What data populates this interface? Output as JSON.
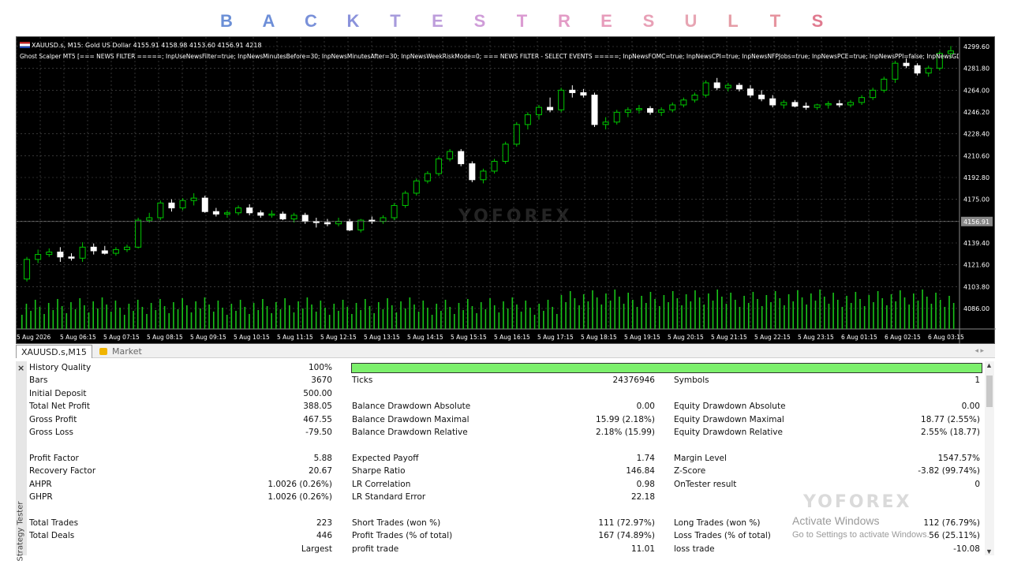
{
  "header_title_letters": [
    {
      "ch": "B",
      "color": "#6b8fd6"
    },
    {
      "ch": "A",
      "color": "#6e8fd8"
    },
    {
      "ch": "C",
      "color": "#7a91d9"
    },
    {
      "ch": "K",
      "color": "#8a92db"
    },
    {
      "ch": "T",
      "color": "#a79bdc"
    },
    {
      "ch": "E",
      "color": "#bd9ddb"
    },
    {
      "ch": "S",
      "color": "#cf9cd8"
    },
    {
      "ch": "T",
      "color": "#db9bd2"
    },
    {
      "ch": "R",
      "color": "#e39cc6"
    },
    {
      "ch": "E",
      "color": "#e79cbb"
    },
    {
      "ch": "S",
      "color": "#e8a0b6"
    },
    {
      "ch": "U",
      "color": "#e7a5b3"
    },
    {
      "ch": "L",
      "color": "#e59ca6"
    },
    {
      "ch": "T",
      "color": "#e6949f"
    },
    {
      "ch": "S",
      "color": "#e07a8f"
    }
  ],
  "chart": {
    "symbol_line": "XAUUSD.s, M15:  Gold US Dollar  4155.91 4158.98 4153.60 4156.91  4218",
    "ea_line": "Ghost Scalper MT5 [=== NEWS FILTER =====; InpUseNewsFilter=true; InpNewsMinutesBefore=30; InpNewsMinutesAfter=30; InpNewsWeekRiskMode=0; === NEWS FILTER - SELECT EVENTS =====; InpNewsFOMC=true; InpNewsCPI=true; InpNewsNFPJobs=true; InpNewsPCE=true; InpNewsPPI=false; InpNewsGD",
    "watermark": "YOFOREX",
    "current_price": "4156.91",
    "colors": {
      "bg": "#000000",
      "grid": "#555555",
      "up": "#00c800",
      "down": "#ffffff",
      "volume": "#19c419",
      "text": "#ffffff"
    }
  },
  "chart_data": {
    "type": "candlestick",
    "price_axis_ticks": [
      "4299.60",
      "4281.80",
      "4264.00",
      "4246.20",
      "4228.40",
      "4210.60",
      "4192.80",
      "4175.00",
      "4157.20",
      "4139.40",
      "4121.60",
      "4103.80",
      "4086.00"
    ],
    "time_axis_ticks": [
      "5 Aug 2026",
      "5 Aug 06:15",
      "5 Aug 07:15",
      "5 Aug 08:15",
      "5 Aug 09:15",
      "5 Aug 10:15",
      "5 Aug 11:15",
      "5 Aug 12:15",
      "5 Aug 13:15",
      "5 Aug 14:15",
      "5 Aug 15:15",
      "5 Aug 16:15",
      "5 Aug 17:15",
      "5 Aug 18:15",
      "5 Aug 19:15",
      "5 Aug 20:15",
      "5 Aug 21:15",
      "5 Aug 22:15",
      "5 Aug 23:15",
      "6 Aug 01:15",
      "6 Aug 02:15",
      "6 Aug 03:15"
    ],
    "ylim": [
      4086.0,
      4299.6
    ],
    "candles": [
      [
        4110,
        4128,
        4108,
        4126
      ],
      [
        4126,
        4134,
        4123,
        4130
      ],
      [
        4130,
        4135,
        4128,
        4132
      ],
      [
        4132,
        4136,
        4124,
        4128
      ],
      [
        4128,
        4131,
        4125,
        4127
      ],
      [
        4127,
        4140,
        4124,
        4136
      ],
      [
        4136,
        4139,
        4130,
        4133
      ],
      [
        4133,
        4137,
        4130,
        4131
      ],
      [
        4131,
        4136,
        4129,
        4134
      ],
      [
        4134,
        4138,
        4132,
        4136
      ],
      [
        4136,
        4160,
        4135,
        4158
      ],
      [
        4158,
        4164,
        4156,
        4160
      ],
      [
        4160,
        4174,
        4158,
        4172
      ],
      [
        4172,
        4175,
        4165,
        4168
      ],
      [
        4168,
        4176,
        4166,
        4174
      ],
      [
        4174,
        4180,
        4170,
        4176
      ],
      [
        4176,
        4178,
        4164,
        4165
      ],
      [
        4165,
        4168,
        4161,
        4163
      ],
      [
        4163,
        4166,
        4160,
        4164
      ],
      [
        4164,
        4170,
        4162,
        4168
      ],
      [
        4168,
        4171,
        4162,
        4164
      ],
      [
        4164,
        4166,
        4160,
        4162
      ],
      [
        4162,
        4166,
        4160,
        4163
      ],
      [
        4163,
        4165,
        4158,
        4159
      ],
      [
        4159,
        4164,
        4156,
        4162
      ],
      [
        4162,
        4164,
        4155,
        4157
      ],
      [
        4157,
        4160,
        4152,
        4156
      ],
      [
        4156,
        4159,
        4153,
        4155
      ],
      [
        4155,
        4160,
        4153,
        4157
      ],
      [
        4157,
        4159,
        4149,
        4150
      ],
      [
        4150,
        4159,
        4148,
        4158
      ],
      [
        4158,
        4161,
        4155,
        4157
      ],
      [
        4157,
        4162,
        4155,
        4160
      ],
      [
        4160,
        4172,
        4158,
        4170
      ],
      [
        4170,
        4182,
        4168,
        4180
      ],
      [
        4180,
        4192,
        4178,
        4190
      ],
      [
        4190,
        4198,
        4188,
        4196
      ],
      [
        4196,
        4210,
        4194,
        4208
      ],
      [
        4208,
        4216,
        4206,
        4214
      ],
      [
        4214,
        4216,
        4202,
        4204
      ],
      [
        4204,
        4206,
        4189,
        4191
      ],
      [
        4191,
        4200,
        4188,
        4198
      ],
      [
        4198,
        4208,
        4196,
        4206
      ],
      [
        4206,
        4222,
        4204,
        4220
      ],
      [
        4220,
        4238,
        4218,
        4236
      ],
      [
        4236,
        4246,
        4232,
        4244
      ],
      [
        4244,
        4252,
        4240,
        4250
      ],
      [
        4250,
        4258,
        4246,
        4248
      ],
      [
        4248,
        4266,
        4246,
        4264
      ],
      [
        4264,
        4268,
        4258,
        4262
      ],
      [
        4262,
        4265,
        4258,
        4260
      ],
      [
        4260,
        4262,
        4234,
        4236
      ],
      [
        4236,
        4242,
        4232,
        4238
      ],
      [
        4238,
        4248,
        4236,
        4246
      ],
      [
        4246,
        4250,
        4242,
        4248
      ],
      [
        4248,
        4252,
        4245,
        4249
      ],
      [
        4249,
        4251,
        4244,
        4246
      ],
      [
        4246,
        4250,
        4243,
        4248
      ],
      [
        4248,
        4254,
        4246,
        4252
      ],
      [
        4252,
        4258,
        4250,
        4256
      ],
      [
        4256,
        4262,
        4254,
        4260
      ],
      [
        4260,
        4272,
        4258,
        4270
      ],
      [
        4270,
        4274,
        4264,
        4266
      ],
      [
        4266,
        4270,
        4263,
        4268
      ],
      [
        4268,
        4270,
        4263,
        4265
      ],
      [
        4265,
        4268,
        4258,
        4260
      ],
      [
        4260,
        4264,
        4255,
        4257
      ],
      [
        4257,
        4260,
        4250,
        4252
      ],
      [
        4252,
        4256,
        4249,
        4254
      ],
      [
        4254,
        4256,
        4250,
        4251
      ],
      [
        4251,
        4254,
        4248,
        4250
      ],
      [
        4250,
        4253,
        4248,
        4252
      ],
      [
        4252,
        4255,
        4249,
        4253
      ],
      [
        4253,
        4256,
        4250,
        4252
      ],
      [
        4252,
        4256,
        4250,
        4254
      ],
      [
        4254,
        4260,
        4252,
        4258
      ],
      [
        4258,
        4266,
        4256,
        4264
      ],
      [
        4264,
        4275,
        4262,
        4273
      ],
      [
        4273,
        4288,
        4270,
        4286
      ],
      [
        4286,
        4290,
        4282,
        4284
      ],
      [
        4284,
        4286,
        4276,
        4278
      ],
      [
        4278,
        4284,
        4275,
        4282
      ],
      [
        4282,
        4296,
        4280,
        4294
      ],
      [
        4294,
        4300,
        4290,
        4296
      ]
    ]
  },
  "tabs": {
    "active": "XAUUSD.s,M15",
    "market": "Market"
  },
  "side_label": "Strategy Tester",
  "results": {
    "col1": [
      {
        "label": "History Quality",
        "value": "100%"
      },
      {
        "label": "Bars",
        "value": "3670"
      },
      {
        "label": "Initial Deposit",
        "value": "500.00"
      },
      {
        "label": "Total Net Profit",
        "value": "388.05"
      },
      {
        "label": "Gross Profit",
        "value": "467.55"
      },
      {
        "label": "Gross Loss",
        "value": "-79.50"
      },
      {
        "label": "",
        "value": ""
      },
      {
        "label": "Profit Factor",
        "value": "5.88"
      },
      {
        "label": "Recovery Factor",
        "value": "20.67"
      },
      {
        "label": "AHPR",
        "value": "1.0026 (0.26%)"
      },
      {
        "label": "GHPR",
        "value": "1.0026 (0.26%)"
      },
      {
        "label": "",
        "value": ""
      },
      {
        "label": "Total Trades",
        "value": "223"
      },
      {
        "label": "Total Deals",
        "value": "446"
      },
      {
        "label": "",
        "value": "Largest"
      }
    ],
    "col2": [
      {
        "label": "",
        "value": ""
      },
      {
        "label": "Ticks",
        "value": "24376946"
      },
      {
        "label": "",
        "value": ""
      },
      {
        "label": "Balance Drawdown Absolute",
        "value": "0.00"
      },
      {
        "label": "Balance Drawdown Maximal",
        "value": "15.99 (2.18%)"
      },
      {
        "label": "Balance Drawdown Relative",
        "value": "2.18% (15.99)"
      },
      {
        "label": "",
        "value": ""
      },
      {
        "label": "Expected Payoff",
        "value": "1.74"
      },
      {
        "label": "Sharpe Ratio",
        "value": "146.84"
      },
      {
        "label": "LR Correlation",
        "value": "0.98"
      },
      {
        "label": "LR Standard Error",
        "value": "22.18"
      },
      {
        "label": "",
        "value": ""
      },
      {
        "label": "Short Trades (won %)",
        "value": "111 (72.97%)"
      },
      {
        "label": "Profit Trades (% of total)",
        "value": "167 (74.89%)"
      },
      {
        "label": "profit trade",
        "value": "11.01"
      }
    ],
    "col3": [
      {
        "label": "",
        "value": ""
      },
      {
        "label": "Symbols",
        "value": "1"
      },
      {
        "label": "",
        "value": ""
      },
      {
        "label": "Equity Drawdown Absolute",
        "value": "0.00"
      },
      {
        "label": "Equity Drawdown Maximal",
        "value": "18.77 (2.55%)"
      },
      {
        "label": "Equity Drawdown Relative",
        "value": "2.55% (18.77)"
      },
      {
        "label": "",
        "value": ""
      },
      {
        "label": "Margin Level",
        "value": "1547.57%"
      },
      {
        "label": "Z-Score",
        "value": "-3.82 (99.74%)"
      },
      {
        "label": "OnTester result",
        "value": "0"
      },
      {
        "label": "",
        "value": ""
      },
      {
        "label": "",
        "value": ""
      },
      {
        "label": "Long Trades (won %)",
        "value": "112 (76.79%)"
      },
      {
        "label": "Loss Trades (% of total)",
        "value": "56 (25.11%)"
      },
      {
        "label": "loss trade",
        "value": "-10.08"
      }
    ]
  },
  "watermark_text": "YOFOREX",
  "activate_windows": {
    "title": "Activate Windows",
    "subtitle": "Go to Settings to activate Windows."
  }
}
